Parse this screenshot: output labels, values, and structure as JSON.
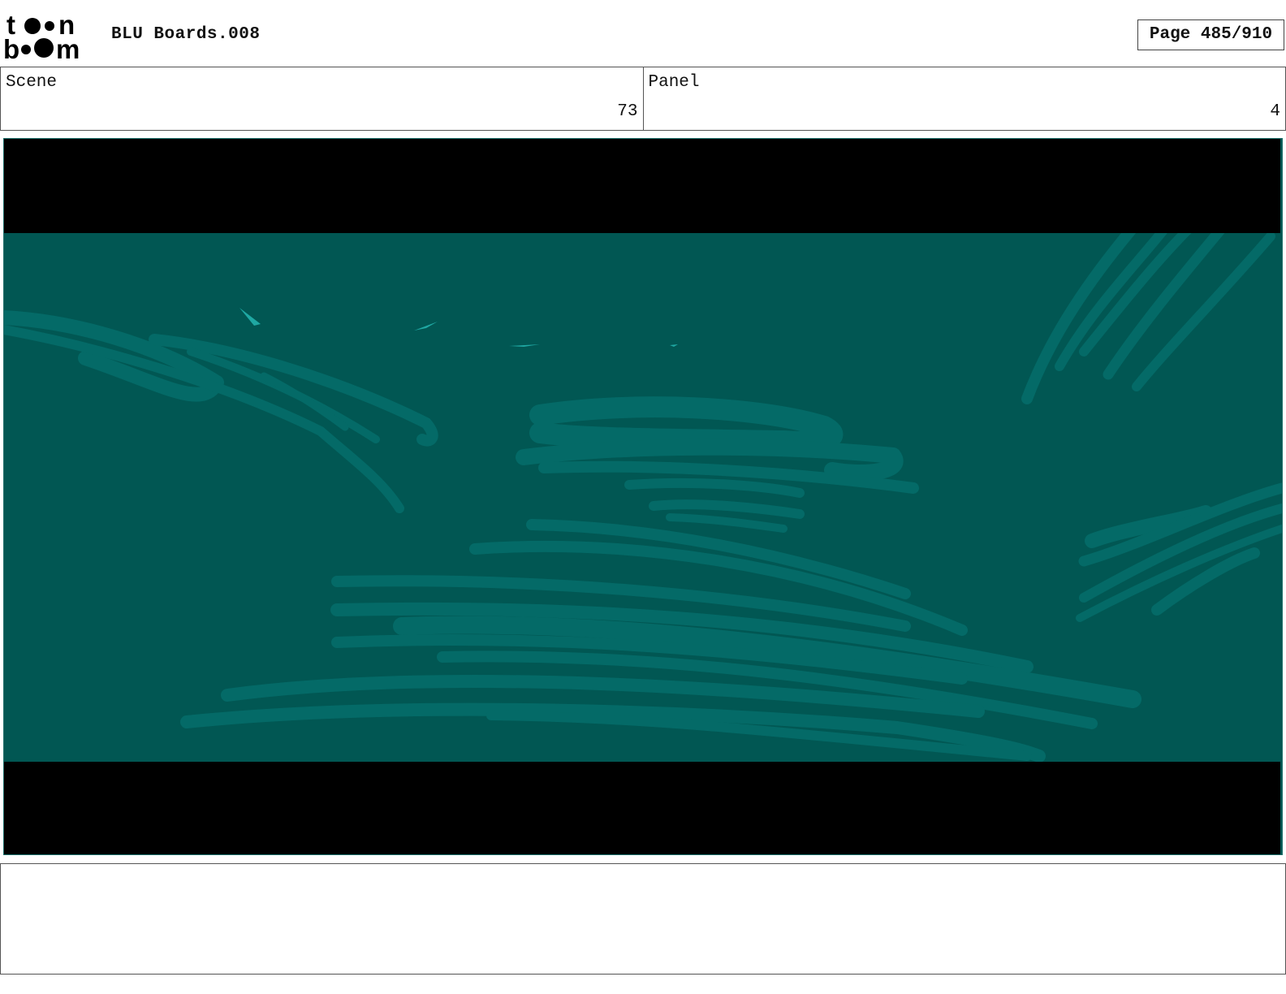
{
  "header": {
    "logo_text": "toon boom",
    "project_title": "BLU Boards.008",
    "page_label": "Page 485/910"
  },
  "fields": [
    {
      "label": "Scene",
      "value": "73"
    },
    {
      "label": "Panel",
      "value": "4"
    }
  ],
  "panel": {
    "background_color": "#015753",
    "stroke_color": "#046a67",
    "highlight_color": "#1fa8a3",
    "letterbox_color": "#000000"
  },
  "notes": {
    "text": ""
  }
}
